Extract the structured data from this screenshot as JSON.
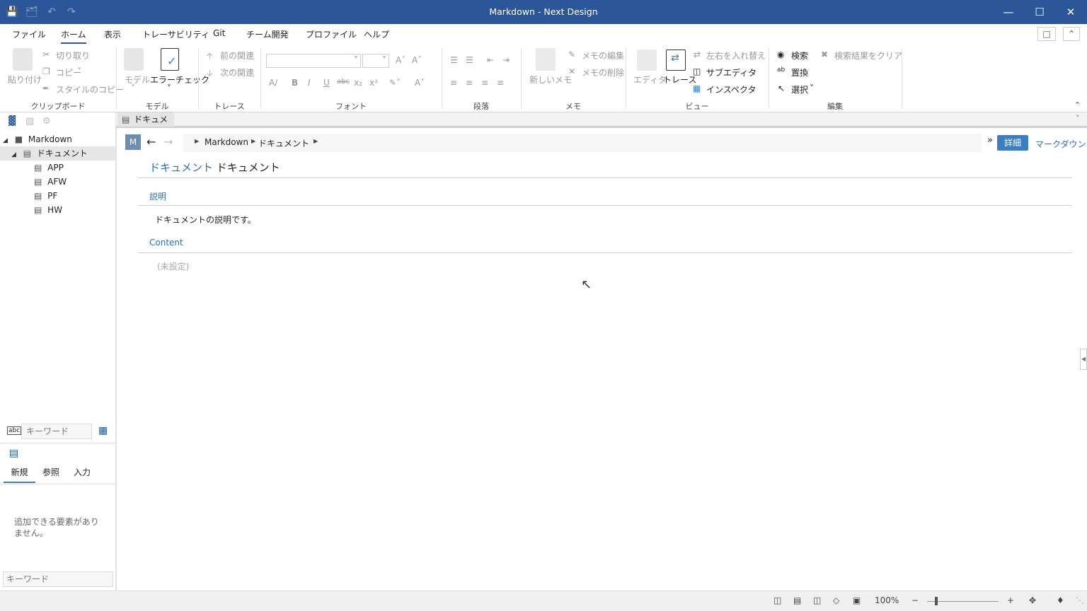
{
  "window": {
    "title": "Markdown - Next Design"
  },
  "menu": {
    "items": [
      "ファイル",
      "ホーム",
      "表示",
      "トレーサビリティ",
      "Git",
      "チーム開発",
      "プロファイル",
      "ヘルプ"
    ]
  },
  "ribbon": {
    "clipboard": {
      "paste": "貼り付け",
      "cut": "切り取り",
      "copy": "コピー",
      "copy_style": "スタイルのコピー",
      "group": "クリップボード"
    },
    "model": {
      "model": "モデル",
      "error_check": "エラーチェック",
      "group": "モデル"
    },
    "trace": {
      "prev": "前の関連",
      "next": "次の関連",
      "group": "トレース"
    },
    "font": {
      "group": "フォント"
    },
    "paragraph": {
      "group": "段落"
    },
    "memo": {
      "new": "新しいメモ",
      "edit": "メモの編集",
      "delete": "メモの削除",
      "group": "メモ"
    },
    "view": {
      "editor": "エディタ",
      "trace": "トレース",
      "swap": "左右を入れ替え",
      "subeditor": "サブエディタ",
      "inspector": "インスペクタ",
      "group": "ビュー"
    },
    "edit": {
      "search": "検索",
      "replace": "置換",
      "select": "選択",
      "clear": "検索結果をクリア",
      "group": "編集"
    }
  },
  "doc_tab": {
    "label": "ドキュメント"
  },
  "tree": {
    "root": "Markdown",
    "doc": "ドキュメント",
    "children": [
      "APP",
      "AFW",
      "PF",
      "HW"
    ]
  },
  "left": {
    "keyword_placeholder": "キーワード",
    "tabs": [
      "新規",
      "参照",
      "入力"
    ],
    "empty_msg": "追加できる要素がありません。",
    "keyword2_placeholder": "キーワード"
  },
  "main": {
    "badge": "M",
    "breadcrumb": [
      "Markdown",
      "ドキュメント"
    ],
    "detail_btn": "詳細",
    "markdown_link": "マークダウン",
    "header_type": "ドキュメント",
    "header_name": "ドキュメント",
    "desc_label": "説明",
    "desc_text": "ドキュメントの説明です。",
    "content_label": "Content",
    "content_value": "(未設定)"
  },
  "status": {
    "zoom": "100%"
  },
  "colors": {
    "accent": "#2b579a",
    "link": "#2e6db4",
    "button": "#3c7fc1"
  }
}
